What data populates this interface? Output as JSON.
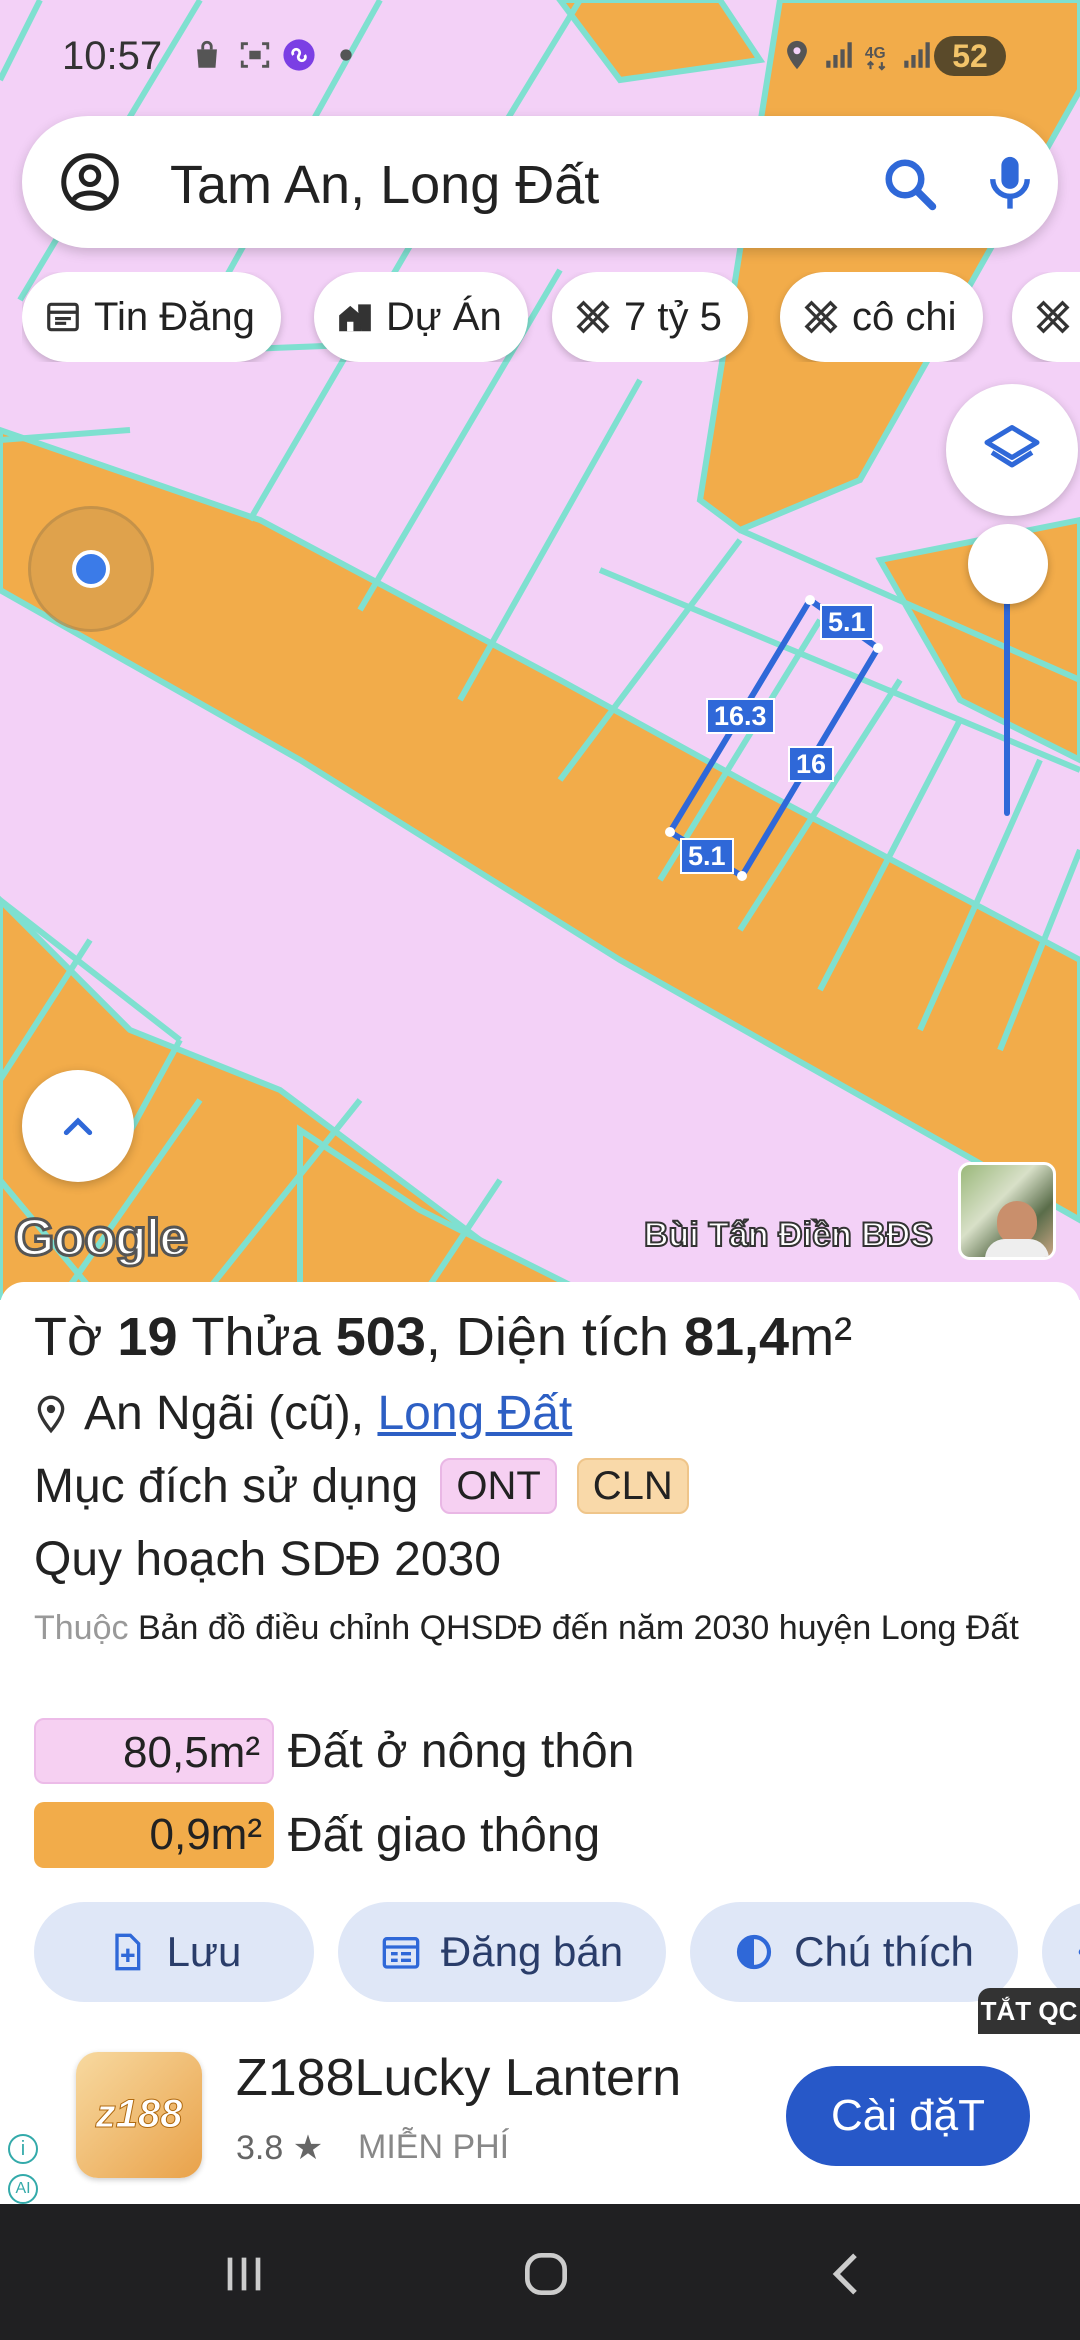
{
  "status_bar": {
    "time": "10:57",
    "battery": "52",
    "network": "4G"
  },
  "search": {
    "query": "Tam An, Long Đất"
  },
  "chips": [
    {
      "label": "Tin Đăng",
      "icon": "list-icon"
    },
    {
      "label": "Dự Án",
      "icon": "building-icon"
    },
    {
      "label": "7 tỷ 5",
      "icon": "ruler-icon"
    },
    {
      "label": "cô chi",
      "icon": "ruler-icon"
    },
    {
      "label": "",
      "icon": "ruler-icon"
    }
  ],
  "map": {
    "logo": "Google",
    "credit": "Bùi Tấn Điền BĐS",
    "parcel_dims": {
      "top": "5.1",
      "left": "16.3",
      "right": "16",
      "bottom": "5.1"
    },
    "colors": {
      "residential": "#f3d1f7",
      "road": "#f2ac4a",
      "boundary": "#7fe0d0",
      "parcel": "#2f68d8"
    }
  },
  "parcel": {
    "to_label": "Tờ",
    "to_value": "19",
    "thua_label": "Thửa",
    "thua_value": "503",
    "dien_tich_label": ", Diện tích",
    "dien_tich_value": "81,4",
    "dien_tich_unit": "m²",
    "location_text": "An Ngãi (cũ),",
    "location_link": "Long Đất",
    "muc_dich_label": "Mục đích sử dụng",
    "tags": [
      "ONT",
      "CLN"
    ],
    "quy_hoach": "Quy hoạch SDĐ 2030",
    "thuoc_prefix": "Thuộc",
    "thuoc_text": "Bản đồ điều chỉnh QHSDĐ đến năm 2030 huyện Long Đất",
    "areas": [
      {
        "value": "80,5m²",
        "label": "Đất ở nông thôn",
        "color": "#f6d0f2"
      },
      {
        "value": "0,9m²",
        "label": "Đất giao thông",
        "color": "#f2ac4a"
      }
    ]
  },
  "actions": [
    {
      "label": "Lưu",
      "icon": "add-file-icon"
    },
    {
      "label": "Đăng bán",
      "icon": "calendar-icon"
    },
    {
      "label": "Chú thích",
      "icon": "contrast-icon"
    },
    {
      "label": "",
      "icon": "more-icon"
    }
  ],
  "ad": {
    "close_label": "TẮT QC",
    "app_icon_text": "z188",
    "app_name": "Z188Lucky Lantern",
    "rating": "3.8 ★",
    "price": "MIỄN PHÍ",
    "install_label": "Cài đặT",
    "info": "i",
    "ai": "AI"
  }
}
